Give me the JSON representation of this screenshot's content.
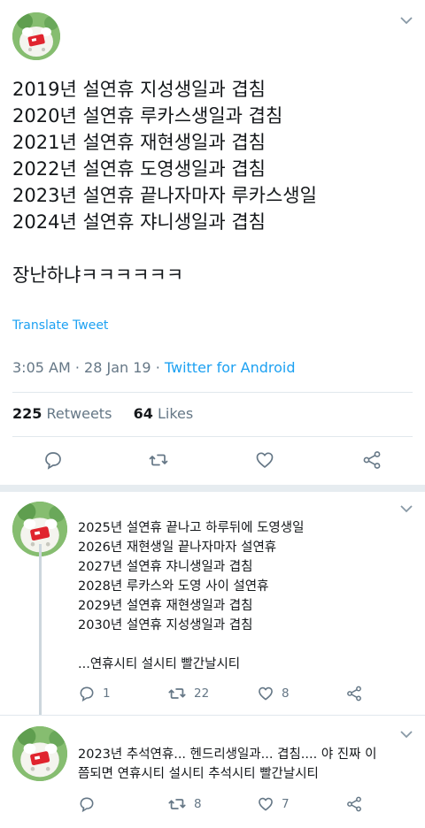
{
  "main_tweet": {
    "lines": [
      "2019년 설연휴 지성생일과 겹침",
      "2020년 설연휴 루카스생일과 겹침",
      "2021년 설연휴 재현생일과 겹침",
      "2022년 설연휴 도영생일과 겹침",
      "2023년 설연휴 끝나자마자 루카스생일",
      "2024년 설연휴 쟈니생일과 겹침"
    ],
    "closing_line": "장난하냐ㅋㅋㅋㅋㅋㅋ",
    "translate_label": "Translate Tweet",
    "time": "3:05 AM",
    "date": "28 Jan 19",
    "source": "Twitter for Android",
    "retweets_count": "225",
    "retweets_label": "Retweets",
    "likes_count": "64",
    "likes_label": "Likes"
  },
  "replies": [
    {
      "lines": [
        "2025년 설연휴 끝나고 하루뒤에 도영생일",
        "2026년 재현생일 끝나자마자 설연휴",
        "2027년 설연휴 쟈니생일과 겹침",
        "2028년 루카스와 도영 사이 설연휴",
        "2029년 설연휴 재현생일과 겹침",
        "2030년 설연휴 지성생일과 겹침"
      ],
      "closing_line": "...연휴시티 설시티 빨간날시티",
      "reply_count": "1",
      "retweet_count": "22",
      "like_count": "8"
    },
    {
      "lines": [
        "2023년 추석연휴... 헨드리생일과... 겹침.... 야 진짜 이",
        "쯤되면 연휴시티 설시티 추석시티 빨간날시티"
      ],
      "reply_count": "",
      "retweet_count": "8",
      "like_count": "7"
    }
  ],
  "icons": {
    "caret": "chevron-down-icon",
    "reply": "reply-icon",
    "retweet": "retweet-icon",
    "like": "heart-icon",
    "share": "share-icon"
  },
  "colors": {
    "link_blue": "#1da1f2",
    "secondary_text": "#657786",
    "divider": "#e1e8ed",
    "section_background": "#e6ecf0"
  }
}
